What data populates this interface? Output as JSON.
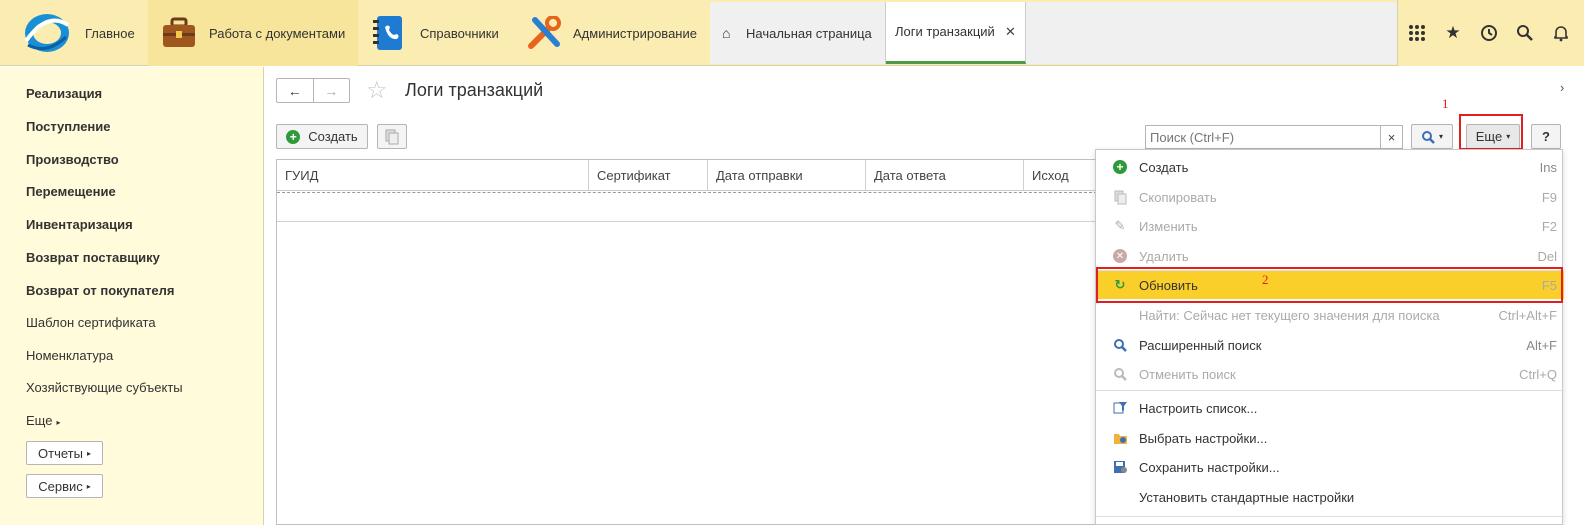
{
  "topbar": {
    "sections": [
      {
        "label": "Главное",
        "icon": "logo-icon"
      },
      {
        "label": "Работа с документами",
        "icon": "briefcase-icon"
      },
      {
        "label": "Справочники",
        "icon": "address-book-icon"
      },
      {
        "label": "Администрирование",
        "icon": "tools-icon"
      }
    ],
    "tabs": [
      {
        "label": "Начальная страница",
        "icon": "home-icon"
      },
      {
        "label": "Логи транзакций",
        "close": "✕"
      }
    ],
    "right_icons": [
      "apps-grid-icon",
      "star-icon",
      "history-icon",
      "search-icon",
      "bell-icon"
    ]
  },
  "sidebar": {
    "items_bold": [
      "Реализация",
      "Поступление",
      "Производство",
      "Перемещение",
      "Инвентаризация",
      "Возврат поставщику",
      "Возврат от покупателя"
    ],
    "items": [
      "Шаблон сертификата",
      "Номенклатура",
      "Хозяйствующие субъекты",
      "Еще"
    ],
    "buttons": [
      "Отчеты",
      "Сервис"
    ]
  },
  "page": {
    "title": "Логи транзакций",
    "create_label": "Создать",
    "search_placeholder": "Поиск (Ctrl+F)",
    "clear": "×",
    "more_label": "Еще",
    "help_label": "?"
  },
  "table": {
    "columns": [
      "ГУИД",
      "Сертификат",
      "Дата отправки",
      "Дата ответа",
      "Исход"
    ]
  },
  "menu": {
    "items": [
      {
        "label": "Создать",
        "shortcut": "Ins",
        "icon": "plus-circle-icon",
        "disabled": false
      },
      {
        "label": "Скопировать",
        "shortcut": "F9",
        "icon": "copy-icon",
        "disabled": true
      },
      {
        "label": "Изменить",
        "shortcut": "F2",
        "icon": "pencil-icon",
        "disabled": true
      },
      {
        "label": "Удалить",
        "shortcut": "Del",
        "icon": "delete-circle-icon",
        "disabled": true
      },
      {
        "label": "Обновить",
        "shortcut": "F5",
        "icon": "refresh-icon",
        "disabled": false,
        "highlighted": true
      },
      {
        "label": "Найти: Сейчас нет текущего значения для поиска",
        "shortcut": "Ctrl+Alt+F",
        "icon": "",
        "disabled": true
      },
      {
        "label": "Расширенный поиск",
        "shortcut": "Alt+F",
        "icon": "advanced-search-icon",
        "disabled": false
      },
      {
        "label": "Отменить поиск",
        "shortcut": "Ctrl+Q",
        "icon": "cancel-search-icon",
        "disabled": true
      },
      {
        "label": "Настроить список...",
        "shortcut": "",
        "icon": "filter-settings-icon",
        "disabled": false
      },
      {
        "label": "Выбрать настройки...",
        "shortcut": "",
        "icon": "folder-settings-icon",
        "disabled": false
      },
      {
        "label": "Сохранить настройки...",
        "shortcut": "",
        "icon": "save-settings-icon",
        "disabled": false
      },
      {
        "label": "Установить стандартные настройки",
        "shortcut": "",
        "icon": "",
        "disabled": false
      }
    ]
  },
  "annotations": {
    "first": "1",
    "second": "2",
    "color": "#e02020"
  },
  "colors": {
    "topbar": "#fbedb2",
    "sidebar": "#fffbdb",
    "highlight": "#fbcf2a",
    "accent_green": "#4d9b47"
  }
}
